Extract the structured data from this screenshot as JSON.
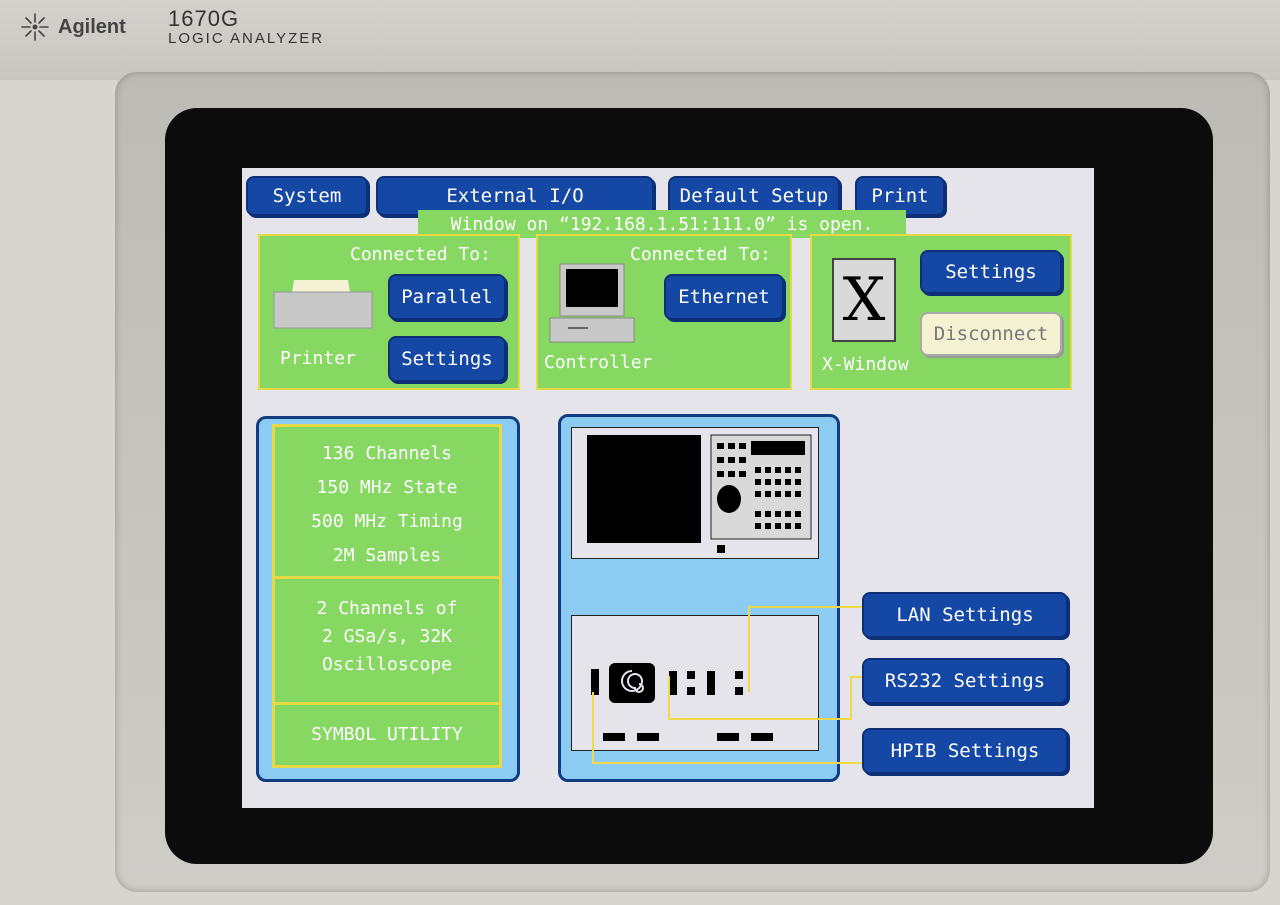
{
  "device": {
    "brand": "Agilent",
    "model": "1670G",
    "subtitle": "LOGIC ANALYZER"
  },
  "menu": {
    "system": "System",
    "external_io": "External I/O",
    "default_setup": "Default Setup",
    "print": "Print"
  },
  "notice": "Window on “192.168.1.51:111.0” is open.",
  "printer": {
    "connected_label": "Connected To:",
    "parallel_button": "Parallel",
    "label": "Printer",
    "settings_button": "Settings"
  },
  "controller": {
    "connected_label": "Connected To:",
    "ethernet_button": "Ethernet",
    "label": "Controller"
  },
  "xwindow": {
    "logo": "X",
    "settings_button": "Settings",
    "disconnect_button": "Disconnect",
    "label": "X-Window"
  },
  "specs": {
    "analyzer": [
      "136 Channels",
      "150 MHz State",
      "500 MHz Timing",
      "2M Samples"
    ],
    "scope": [
      "2 Channels of",
      "2 GSa/s, 32K",
      "Oscilloscope"
    ],
    "symbol_utility": "SYMBOL UTILITY"
  },
  "io_buttons": {
    "lan": "LAN Settings",
    "rs232": "RS232 Settings",
    "hpib": "HPIB Settings"
  },
  "colors": {
    "button_blue": "#1547a5",
    "panel_green": "#86d862",
    "panel_blue": "#8ccbf2",
    "border_yellow": "#e7d848",
    "screen_bg": "#e4e4ea"
  }
}
